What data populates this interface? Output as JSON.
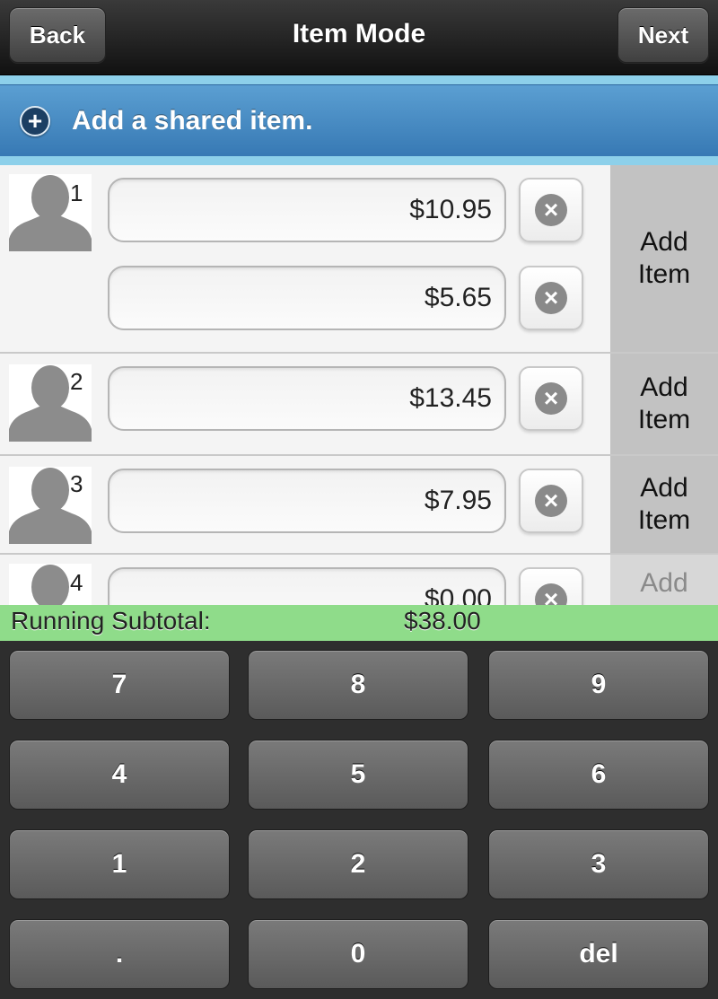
{
  "header": {
    "back_label": "Back",
    "title": "Item Mode",
    "next_label": "Next"
  },
  "shared": {
    "label": "Add a shared item."
  },
  "people": [
    {
      "number": "1",
      "items": [
        "$10.95",
        "$5.65"
      ],
      "add_label": "Add Item"
    },
    {
      "number": "2",
      "items": [
        "$13.45"
      ],
      "add_label": "Add Item"
    },
    {
      "number": "3",
      "items": [
        "$7.95"
      ],
      "add_label": "Add Item"
    },
    {
      "number": "4",
      "items": [
        "$0.00"
      ],
      "add_label": "Add"
    }
  ],
  "subtotal": {
    "label": "Running Subtotal:",
    "value": "$38.00"
  },
  "keypad": {
    "keys": [
      "7",
      "8",
      "9",
      "4",
      "5",
      "6",
      "1",
      "2",
      "3",
      ".",
      "0",
      "del"
    ]
  },
  "colors": {
    "shared_bar": "#3779b4",
    "subtotal_bar": "#8fdc8a",
    "add_item_panel": "#c2c2c2"
  },
  "icons": {
    "shared": "plus-circle-icon",
    "delete": "close-circle-icon",
    "avatar": "person-silhouette-icon"
  }
}
